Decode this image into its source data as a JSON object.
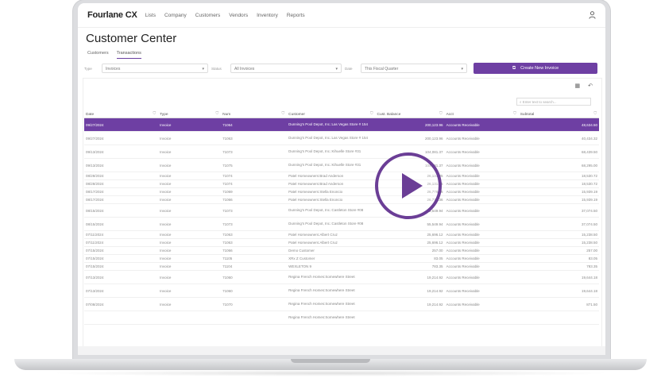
{
  "nav": {
    "logo": "Fourlane CX",
    "items": [
      "Lists",
      "Company",
      "Customers",
      "Vendors",
      "Inventory",
      "Reports"
    ]
  },
  "page": {
    "title": "Customer Center"
  },
  "tabs": [
    {
      "label": "Customers"
    },
    {
      "label": "Transactions"
    }
  ],
  "filters": {
    "type_label": "Type",
    "type_value": "Invoices",
    "status_label": "Status",
    "status_value": "All Invoices",
    "date_label": "Date",
    "date_value": "This Fiscal Quarter"
  },
  "create_button": {
    "label": "Create New Invoice"
  },
  "search": {
    "placeholder": "Enter text to search..."
  },
  "table": {
    "headers": [
      "Date",
      "Type",
      "Num",
      "Customer",
      "Cust. Balance",
      "Acct",
      "Subtotal"
    ],
    "rows": [
      {
        "date": "09/27/2024",
        "type": "Invoice",
        "num": "71064",
        "customer": "Dunning's Pool Depot, Inc.:Las Vegas Store # 154",
        "bal": "200,123.96",
        "acct": "Accounts Receivable",
        "sub": "48,634.50",
        "sel": true,
        "tall": true
      },
      {
        "date": "09/27/2024",
        "type": "Invoice",
        "num": "71063",
        "customer": "Dunning's Pool Depot, Inc.:Las Vegas Store # 154",
        "bal": "200,123.96",
        "acct": "Accounts Receivable",
        "sub": "40,434.32",
        "tall": true
      },
      {
        "date": "09/13/2024",
        "type": "Invoice",
        "num": "71073",
        "customer": "Dunning's Pool Depot, Inc.:Kihuelle Store #31",
        "bal": "104,081.37",
        "acct": "Accounts Receivable",
        "sub": "68,439.50",
        "tall": true
      },
      {
        "date": "09/13/2024",
        "type": "Invoice",
        "num": "71075",
        "customer": "Dunning's Pool Depot, Inc.:Kihuelle Store #31",
        "bal": "104,081.37",
        "acct": "Accounts Receivable",
        "sub": "68,295.00",
        "tall": true
      },
      {
        "date": "08/28/2024",
        "type": "Invoice",
        "num": "71074",
        "customer": "Patel Homeowners:Brad Anderson",
        "bal": "26,131.05",
        "acct": "Accounts Receivable",
        "sub": "18,530.72"
      },
      {
        "date": "08/28/2024",
        "type": "Invoice",
        "num": "71074",
        "customer": "Patel Homeowners:Brad Anderson",
        "bal": "26,131.05",
        "acct": "Accounts Receivable",
        "sub": "18,530.72"
      },
      {
        "date": "08/17/2024",
        "type": "Invoice",
        "num": "71069",
        "customer": "Patel Homeowners:Stella Enoncio",
        "bal": "26,776.36",
        "acct": "Accounts Receivable",
        "sub": "15,939.19"
      },
      {
        "date": "08/17/2024",
        "type": "Invoice",
        "num": "71066",
        "customer": "Patel Homeowners:Stella Enoncio",
        "bal": "26,776.36",
        "acct": "Accounts Receivable",
        "sub": "15,939.19"
      },
      {
        "date": "08/15/2024",
        "type": "Invoice",
        "num": "71073",
        "customer": "Dunning's Pool Depot, Inc.:Castleton Store #08",
        "bal": "55,549.94",
        "acct": "Accounts Receivable",
        "sub": "37,074.50",
        "tall": true
      },
      {
        "date": "08/15/2024",
        "type": "Invoice",
        "num": "71073",
        "customer": "Dunning's Pool Depot, Inc.:Castleton Store #08",
        "bal": "55,549.94",
        "acct": "Accounts Receivable",
        "sub": "37,074.50",
        "tall": true
      },
      {
        "date": "07/11/2024",
        "type": "Invoice",
        "num": "71063",
        "customer": "Patel Homeowners:Albert Cruz",
        "bal": "25,696.12",
        "acct": "Accounts Receivable",
        "sub": "15,238.50"
      },
      {
        "date": "07/11/2024",
        "type": "Invoice",
        "num": "71063",
        "customer": "Patel Homeowners:Albert Cruz",
        "bal": "25,696.12",
        "acct": "Accounts Receivable",
        "sub": "15,238.50"
      },
      {
        "date": "07/15/2024",
        "type": "Invoice",
        "num": "71066",
        "customer": "Demo Customer",
        "bal": "257.00",
        "acct": "Accounts Receivable",
        "sub": "257.00"
      },
      {
        "date": "07/15/2024",
        "type": "Invoice",
        "num": "71105",
        "customer": "XRx Z Customer",
        "bal": "83.05",
        "acct": "Accounts Receivable",
        "sub": "83.05"
      },
      {
        "date": "07/15/2024",
        "type": "Invoice",
        "num": "71104",
        "customer": "WEXLETON 9",
        "bal": "783.35",
        "acct": "Accounts Receivable",
        "sub": "783.35"
      },
      {
        "date": "07/13/2024",
        "type": "Invoice",
        "num": "71060",
        "customer": "Regina French Homes:Somewhere Street",
        "bal": "19,214.92",
        "acct": "Accounts Receivable",
        "sub": "19,644.18",
        "tall": true
      },
      {
        "date": "07/13/2024",
        "type": "Invoice",
        "num": "71060",
        "customer": "Regina French Homes:Somewhere Street",
        "bal": "19,214.92",
        "acct": "Accounts Receivable",
        "sub": "19,644.18",
        "tall": true
      },
      {
        "date": "07/08/2024",
        "type": "Invoice",
        "num": "71070",
        "customer": "Regina French Homes:Somewhere Street",
        "bal": "19,214.92",
        "acct": "Accounts Receivable",
        "sub": "871.50",
        "tall": true
      },
      {
        "date": "",
        "type": "",
        "num": "",
        "customer": "Regina French Homes:Somewhere Street",
        "bal": "",
        "acct": "",
        "sub": "",
        "tall": true
      }
    ]
  },
  "colors": {
    "accent": "#6e3fa3"
  },
  "icons": [
    "user-icon",
    "filter-icon",
    "columns-icon",
    "undo-icon",
    "search-icon",
    "create-icon",
    "play-icon"
  ]
}
